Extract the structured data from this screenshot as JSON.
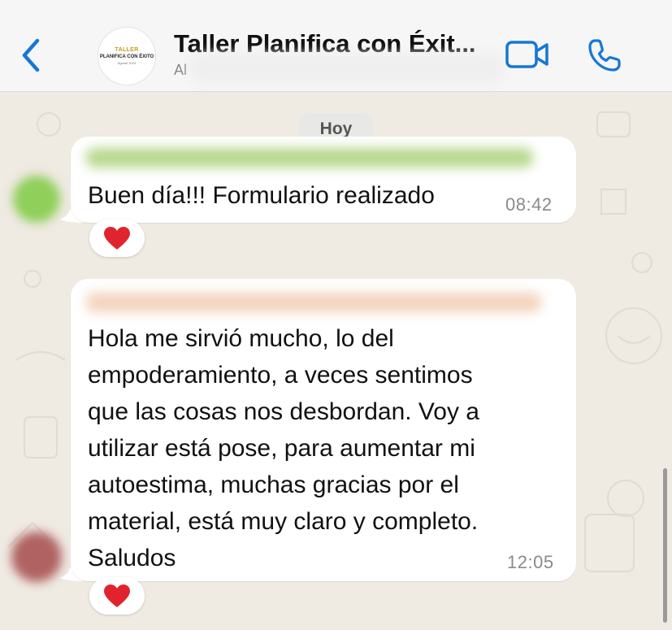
{
  "header": {
    "title": "Taller Planifica con Éxit...",
    "subtitle": "Al",
    "avatar_text_top": "TALLER",
    "avatar_text_main": "PLANIFICA CON ÉXITO",
    "avatar_text_bottom": "Agosto 2024",
    "icons": {
      "back": "chevron-left-icon",
      "video": "video-camera-icon",
      "phone": "phone-icon"
    },
    "accent_color": "#1677d6"
  },
  "chat": {
    "date_label": "Hoy",
    "messages": [
      {
        "text": "Buen día!!! Formulario realizado",
        "time": "08:42",
        "reaction": "❤️"
      },
      {
        "lines": [
          "Hola me sirvió mucho, lo del",
          "empoderamiento, a veces sentimos",
          "que las cosas nos desbordan. Voy a",
          "utilizar está pose, para aumentar mi",
          "autoestima, muchas gracias por el",
          "material, está muy claro y completo.",
          "Saludos"
        ],
        "time": "12:05",
        "reaction": "❤️"
      }
    ]
  },
  "colors": {
    "chat_background": "#efeae2",
    "bubble": "#ffffff",
    "header": "#f6f6f6"
  }
}
